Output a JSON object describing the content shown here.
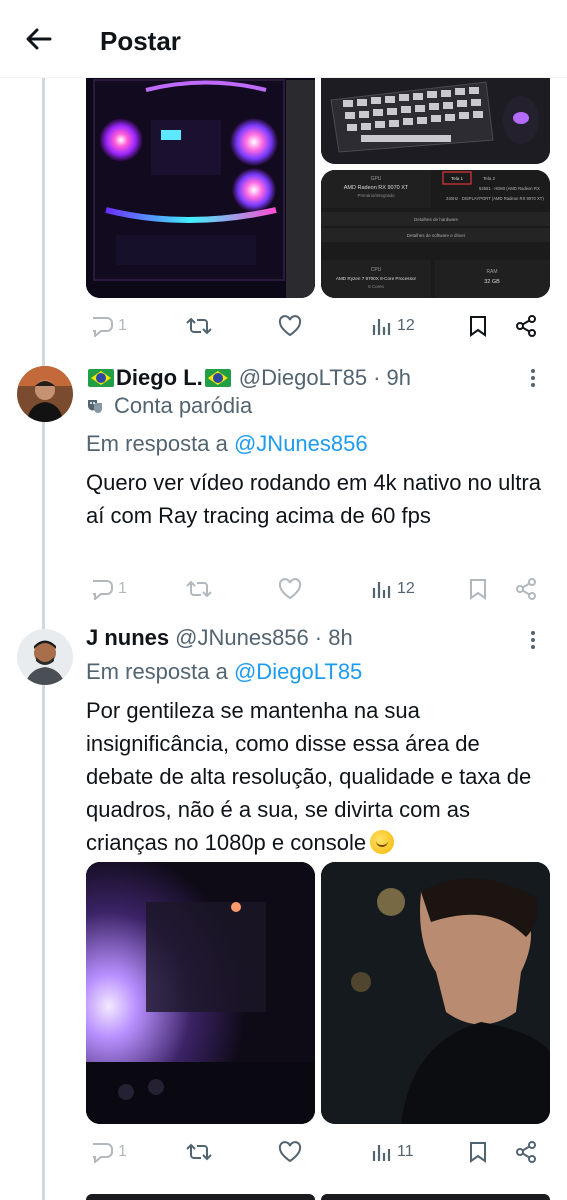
{
  "header": {
    "title": "Postar",
    "back_icon": "arrow-left-icon"
  },
  "top_tweet": {
    "media": {
      "left_image": "pc-case-rgb-fans",
      "top_right_image": "rgb-keyboard-mouse",
      "bottom_right_image": {
        "gpu_label": "GPU",
        "gpu_name": "AMD Radeon RX 9070 XT",
        "gpu_sub": "Primário/Integrado",
        "tab_1": "Tela 1",
        "tab_2": "Tela 2",
        "display_info": "52551 · HDMI (AMD Radeon RX",
        "display_info_2": "240Hz · DISPLAYPORT (AMD Radeon RX 9070 XT)",
        "hardware_row": "Detalhes de hardware",
        "software_row": "Detalhes de software e driver",
        "cpu_label": "CPU",
        "cpu_name": "AMD Ryzen 7 9700X 8-Core Processor",
        "cpu_sub": "8 Cores",
        "ram_label": "RAM",
        "ram_value": "32 GB"
      }
    },
    "actions": {
      "replies": "1",
      "views": "12"
    }
  },
  "reply_1": {
    "display_name": "Diego L.",
    "handle": "@DiegoLT85",
    "time": "· 9h",
    "parody_label": "Conta paródia",
    "reply_prefix": "Em resposta a",
    "reply_to": "@JNunes856",
    "text": "Quero ver vídeo rodando em 4k nativo no ultra aí com Ray tracing acima de 60 fps",
    "actions": {
      "replies": "1",
      "views": "12"
    }
  },
  "reply_2": {
    "display_name": "J nunes",
    "handle": "@JNunes856",
    "time": "· 8h",
    "reply_prefix": "Em resposta a",
    "reply_to": "@DiegoLT85",
    "text": "Por gentileza se mantenha na sua insignificância,  como disse essa área de debate de alta resolução,  qualidade e taxa de quadros, não é a sua, se divirta com as crianças no 1080p e console",
    "media": {
      "left_image": "dark-room-purple-light",
      "right_image": "man-looking-sideways-gif"
    },
    "actions": {
      "replies": "1",
      "views": "11"
    }
  },
  "colors": {
    "text_primary": "#0f1419",
    "text_secondary": "#536471",
    "link": "#1d9bf0",
    "thread_line": "#cfd9de",
    "divider": "#eff3f4"
  }
}
